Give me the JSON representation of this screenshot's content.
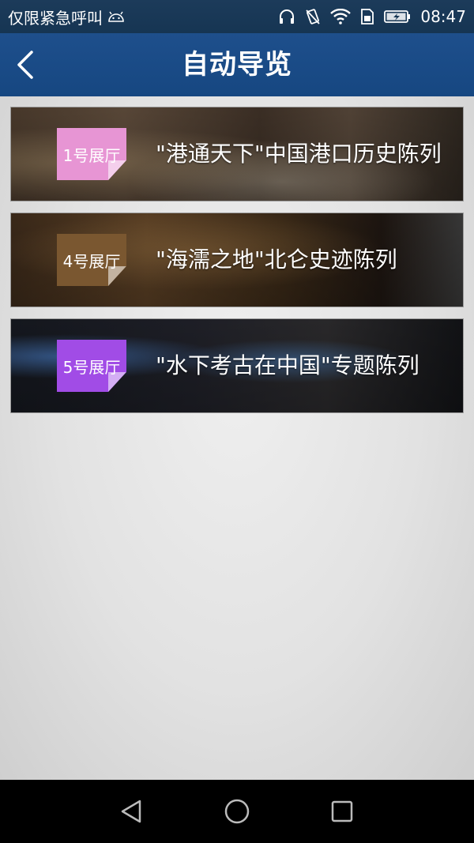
{
  "status_bar": {
    "carrier_text": "仅限紧急呼叫",
    "time": "08:47",
    "icons": [
      "android-icon",
      "headphones-icon",
      "vibrate-icon",
      "wifi-icon",
      "sim-icon",
      "battery-charging-icon"
    ]
  },
  "header": {
    "title": "自动导览",
    "back_icon": "chevron-left-icon"
  },
  "halls": [
    {
      "badge": "1号展厅",
      "title": "\"港通天下\"中国港口历史陈列",
      "badge_color": "#e795d4"
    },
    {
      "badge": "4号展厅",
      "title": "\"海濡之地\"北仑史迹陈列",
      "badge_color": "#7a5730"
    },
    {
      "badge": "5号展厅",
      "title": "\"水下考古在中国\"专题陈列",
      "badge_color": "#a14ce6"
    }
  ],
  "colors": {
    "status_bar": "#1c3b5a",
    "title_bar": "#1e4f8c",
    "nav_bar": "#000000"
  },
  "nav_bar": {
    "icons": [
      "back-triangle-icon",
      "home-circle-icon",
      "recents-square-icon"
    ]
  }
}
